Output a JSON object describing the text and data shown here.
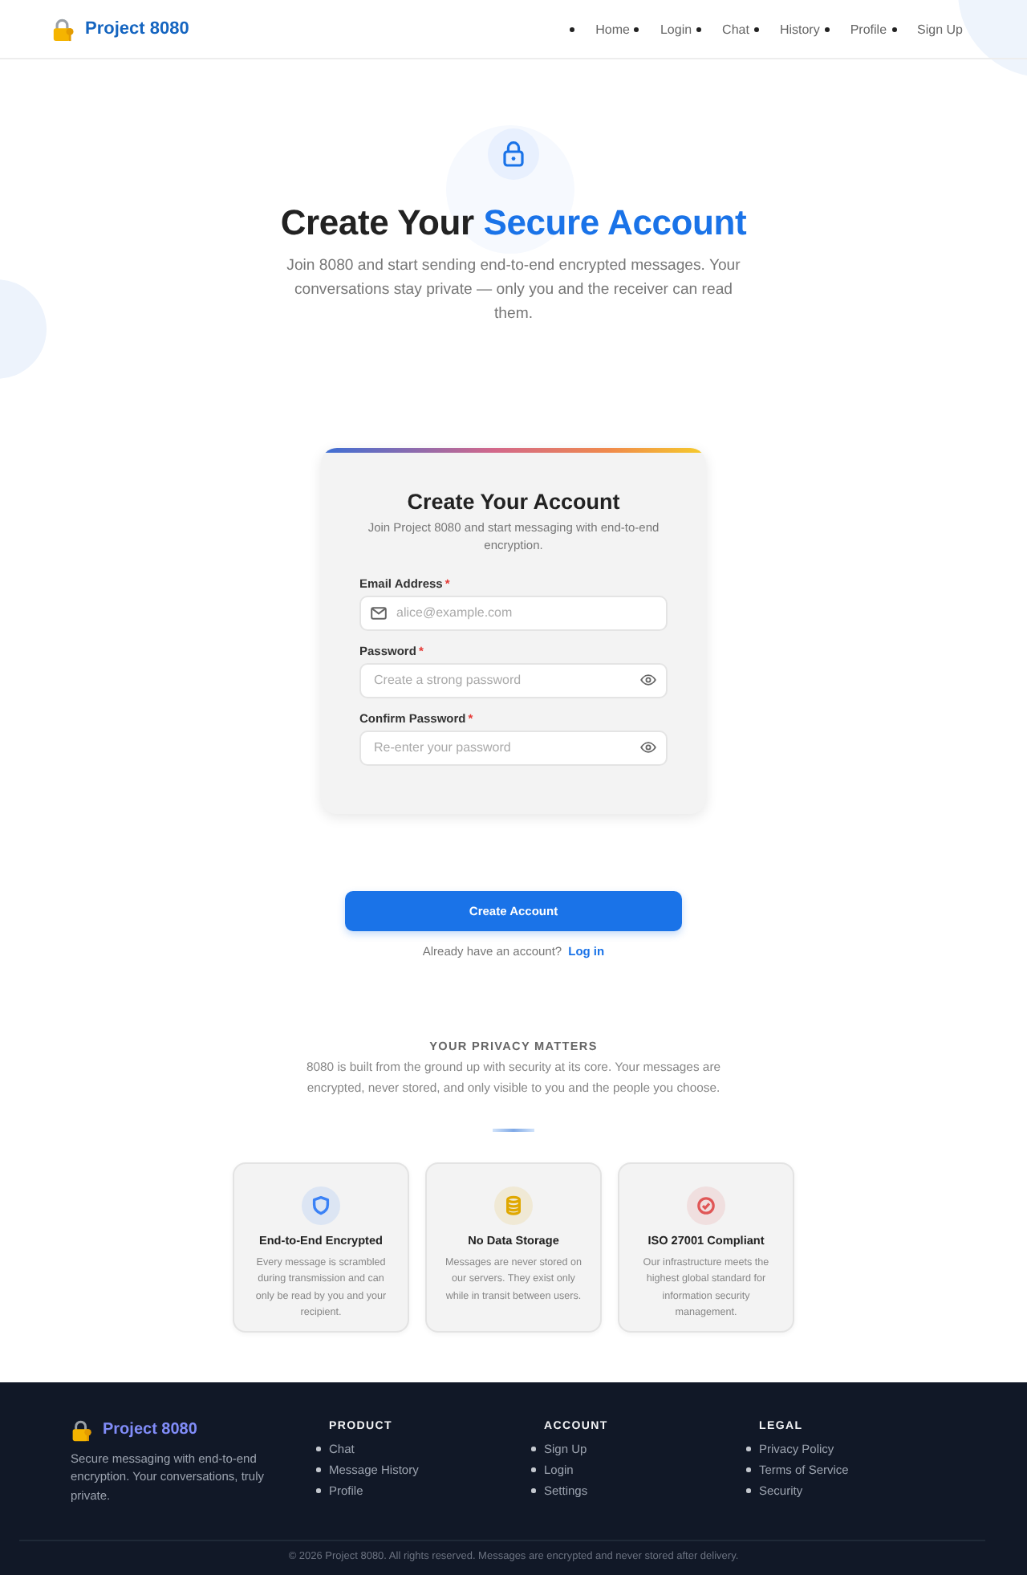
{
  "header": {
    "logo": "Project 8080",
    "nav": [
      {
        "label": "Home"
      },
      {
        "label": "Login"
      },
      {
        "label": "Chat"
      },
      {
        "label": "History"
      },
      {
        "label": "Profile"
      },
      {
        "label": "Sign Up"
      }
    ]
  },
  "hero": {
    "title": [
      {
        "text": "Create Your",
        "kind": "plain"
      },
      {
        "text": "Secure Account",
        "kind": "accent"
      }
    ],
    "subtitle": "Join 8080 and start sending end-to-end encrypted messages. Your conversations stay private — only you and the receiver can read them."
  },
  "signup_form": {
    "title": "Create Your Account",
    "subtitle": "Join Project 8080 and start messaging with end-to-end encryption.",
    "fields": [
      {
        "label": "Email Address",
        "required_mark": "*",
        "kind": "email",
        "placeholder": "alice@example.com"
      },
      {
        "label": "Password",
        "required_mark": "*",
        "kind": "password",
        "placeholder": "Create a strong password"
      },
      {
        "label": "Confirm Password",
        "required_mark": "*",
        "kind": "password",
        "placeholder": "Re-enter your password"
      }
    ]
  },
  "submit_button": "Create Account",
  "login_prompt": {
    "text": "Already have an account?",
    "link": "Log in"
  },
  "privacy": {
    "heading": "YOUR PRIVACY MATTERS",
    "text": "8080 is built from the ground up with security at its core. Your messages are encrypted, never stored, and only visible to you and the people you choose.",
    "features": [
      {
        "kind": "shield",
        "color": "#3b82f6",
        "title": "End-to-End Encrypted",
        "text": "Every message is scrambled during transmission and can only be read by you and your recipient."
      },
      {
        "kind": "database",
        "color": "#e0a800",
        "title": "No Data Storage",
        "text": "Messages are never stored on our servers. They exist only while in transit between users."
      },
      {
        "kind": "check",
        "color": "#e05656",
        "title": "ISO 27001 Compliant",
        "text": "Our infrastructure meets the highest global standard for information security management."
      }
    ]
  },
  "footer": {
    "logo": "Project 8080",
    "tagline": "Secure messaging with end-to-end encryption. Your conversations, truly private.",
    "columns": [
      {
        "heading": "PRODUCT",
        "links": [
          "Chat",
          "Message History",
          "Profile"
        ]
      },
      {
        "heading": "ACCOUNT",
        "links": [
          "Sign Up",
          "Login",
          "Settings"
        ]
      },
      {
        "heading": "LEGAL",
        "links": [
          "Privacy Policy",
          "Terms of Service",
          "Security"
        ]
      }
    ],
    "copyright": "© 2026 Project 8080. All rights reserved. Messages are encrypted and never stored after delivery."
  }
}
